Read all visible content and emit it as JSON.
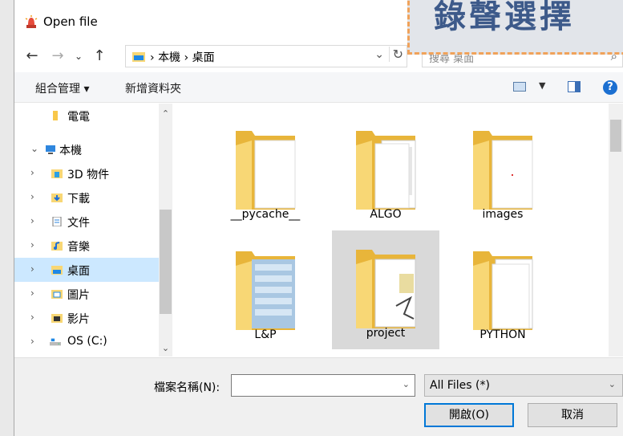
{
  "window": {
    "title": "Open file"
  },
  "banner": {
    "text": "錄聲選擇"
  },
  "address": {
    "path": [
      "本機",
      "桌面"
    ],
    "search_placeholder": "搜尋 桌面"
  },
  "toolbar": {
    "organize_label": "組合管理 ▾",
    "new_folder_label": "新增資料夾"
  },
  "nav": {
    "items": [
      {
        "label": "電電",
        "icon": "folder-icon"
      },
      {
        "label": "本機",
        "icon": "computer-icon"
      },
      {
        "label": "3D 物件",
        "icon": "3d-objects-icon"
      },
      {
        "label": "下載",
        "icon": "downloads-icon"
      },
      {
        "label": "文件",
        "icon": "documents-icon"
      },
      {
        "label": "音樂",
        "icon": "music-icon"
      },
      {
        "label": "桌面",
        "icon": "desktop-icon",
        "selected": true
      },
      {
        "label": "圖片",
        "icon": "pictures-icon"
      },
      {
        "label": "影片",
        "icon": "videos-icon"
      },
      {
        "label": "OS (C:)",
        "icon": "drive-icon"
      }
    ]
  },
  "files": {
    "items": [
      {
        "name": "__pycache__"
      },
      {
        "name": "ALGO"
      },
      {
        "name": "images"
      },
      {
        "name": "L&P"
      },
      {
        "name": "project",
        "selected": true
      },
      {
        "name": "PYTHON"
      }
    ]
  },
  "footer": {
    "filename_label": "檔案名稱(N):",
    "filename_value": "",
    "filetype_value": "All Files  (*)",
    "open_label": "開啟(O)",
    "cancel_label": "取消"
  },
  "colors": {
    "accent": "#0078d7",
    "selection": "#cce8ff",
    "folder": "#f8d775"
  }
}
